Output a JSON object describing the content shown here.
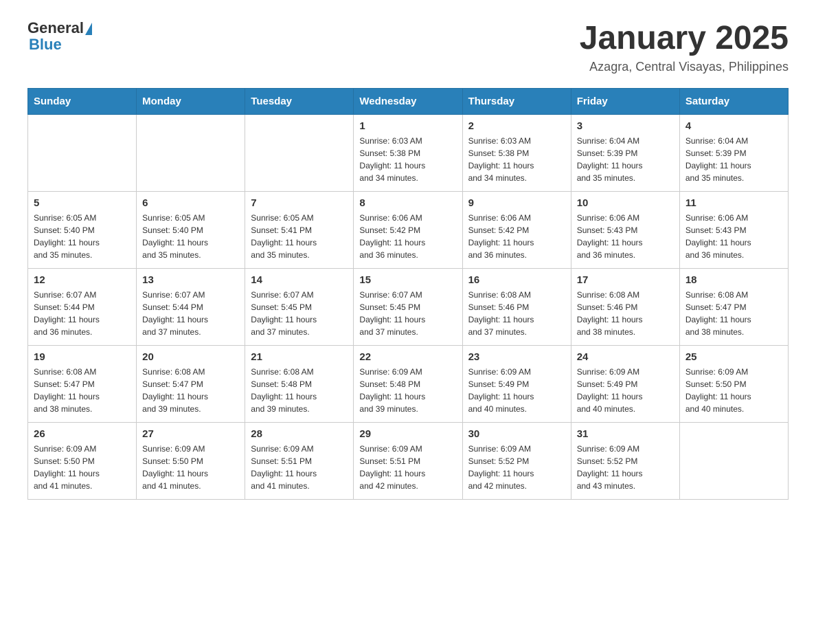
{
  "header": {
    "logo_general": "General",
    "logo_blue": "Blue",
    "month_title": "January 2025",
    "location": "Azagra, Central Visayas, Philippines"
  },
  "days_of_week": [
    "Sunday",
    "Monday",
    "Tuesday",
    "Wednesday",
    "Thursday",
    "Friday",
    "Saturday"
  ],
  "weeks": [
    [
      {
        "day": "",
        "info": ""
      },
      {
        "day": "",
        "info": ""
      },
      {
        "day": "",
        "info": ""
      },
      {
        "day": "1",
        "info": "Sunrise: 6:03 AM\nSunset: 5:38 PM\nDaylight: 11 hours\nand 34 minutes."
      },
      {
        "day": "2",
        "info": "Sunrise: 6:03 AM\nSunset: 5:38 PM\nDaylight: 11 hours\nand 34 minutes."
      },
      {
        "day": "3",
        "info": "Sunrise: 6:04 AM\nSunset: 5:39 PM\nDaylight: 11 hours\nand 35 minutes."
      },
      {
        "day": "4",
        "info": "Sunrise: 6:04 AM\nSunset: 5:39 PM\nDaylight: 11 hours\nand 35 minutes."
      }
    ],
    [
      {
        "day": "5",
        "info": "Sunrise: 6:05 AM\nSunset: 5:40 PM\nDaylight: 11 hours\nand 35 minutes."
      },
      {
        "day": "6",
        "info": "Sunrise: 6:05 AM\nSunset: 5:40 PM\nDaylight: 11 hours\nand 35 minutes."
      },
      {
        "day": "7",
        "info": "Sunrise: 6:05 AM\nSunset: 5:41 PM\nDaylight: 11 hours\nand 35 minutes."
      },
      {
        "day": "8",
        "info": "Sunrise: 6:06 AM\nSunset: 5:42 PM\nDaylight: 11 hours\nand 36 minutes."
      },
      {
        "day": "9",
        "info": "Sunrise: 6:06 AM\nSunset: 5:42 PM\nDaylight: 11 hours\nand 36 minutes."
      },
      {
        "day": "10",
        "info": "Sunrise: 6:06 AM\nSunset: 5:43 PM\nDaylight: 11 hours\nand 36 minutes."
      },
      {
        "day": "11",
        "info": "Sunrise: 6:06 AM\nSunset: 5:43 PM\nDaylight: 11 hours\nand 36 minutes."
      }
    ],
    [
      {
        "day": "12",
        "info": "Sunrise: 6:07 AM\nSunset: 5:44 PM\nDaylight: 11 hours\nand 36 minutes."
      },
      {
        "day": "13",
        "info": "Sunrise: 6:07 AM\nSunset: 5:44 PM\nDaylight: 11 hours\nand 37 minutes."
      },
      {
        "day": "14",
        "info": "Sunrise: 6:07 AM\nSunset: 5:45 PM\nDaylight: 11 hours\nand 37 minutes."
      },
      {
        "day": "15",
        "info": "Sunrise: 6:07 AM\nSunset: 5:45 PM\nDaylight: 11 hours\nand 37 minutes."
      },
      {
        "day": "16",
        "info": "Sunrise: 6:08 AM\nSunset: 5:46 PM\nDaylight: 11 hours\nand 37 minutes."
      },
      {
        "day": "17",
        "info": "Sunrise: 6:08 AM\nSunset: 5:46 PM\nDaylight: 11 hours\nand 38 minutes."
      },
      {
        "day": "18",
        "info": "Sunrise: 6:08 AM\nSunset: 5:47 PM\nDaylight: 11 hours\nand 38 minutes."
      }
    ],
    [
      {
        "day": "19",
        "info": "Sunrise: 6:08 AM\nSunset: 5:47 PM\nDaylight: 11 hours\nand 38 minutes."
      },
      {
        "day": "20",
        "info": "Sunrise: 6:08 AM\nSunset: 5:47 PM\nDaylight: 11 hours\nand 39 minutes."
      },
      {
        "day": "21",
        "info": "Sunrise: 6:08 AM\nSunset: 5:48 PM\nDaylight: 11 hours\nand 39 minutes."
      },
      {
        "day": "22",
        "info": "Sunrise: 6:09 AM\nSunset: 5:48 PM\nDaylight: 11 hours\nand 39 minutes."
      },
      {
        "day": "23",
        "info": "Sunrise: 6:09 AM\nSunset: 5:49 PM\nDaylight: 11 hours\nand 40 minutes."
      },
      {
        "day": "24",
        "info": "Sunrise: 6:09 AM\nSunset: 5:49 PM\nDaylight: 11 hours\nand 40 minutes."
      },
      {
        "day": "25",
        "info": "Sunrise: 6:09 AM\nSunset: 5:50 PM\nDaylight: 11 hours\nand 40 minutes."
      }
    ],
    [
      {
        "day": "26",
        "info": "Sunrise: 6:09 AM\nSunset: 5:50 PM\nDaylight: 11 hours\nand 41 minutes."
      },
      {
        "day": "27",
        "info": "Sunrise: 6:09 AM\nSunset: 5:50 PM\nDaylight: 11 hours\nand 41 minutes."
      },
      {
        "day": "28",
        "info": "Sunrise: 6:09 AM\nSunset: 5:51 PM\nDaylight: 11 hours\nand 41 minutes."
      },
      {
        "day": "29",
        "info": "Sunrise: 6:09 AM\nSunset: 5:51 PM\nDaylight: 11 hours\nand 42 minutes."
      },
      {
        "day": "30",
        "info": "Sunrise: 6:09 AM\nSunset: 5:52 PM\nDaylight: 11 hours\nand 42 minutes."
      },
      {
        "day": "31",
        "info": "Sunrise: 6:09 AM\nSunset: 5:52 PM\nDaylight: 11 hours\nand 43 minutes."
      },
      {
        "day": "",
        "info": ""
      }
    ]
  ]
}
